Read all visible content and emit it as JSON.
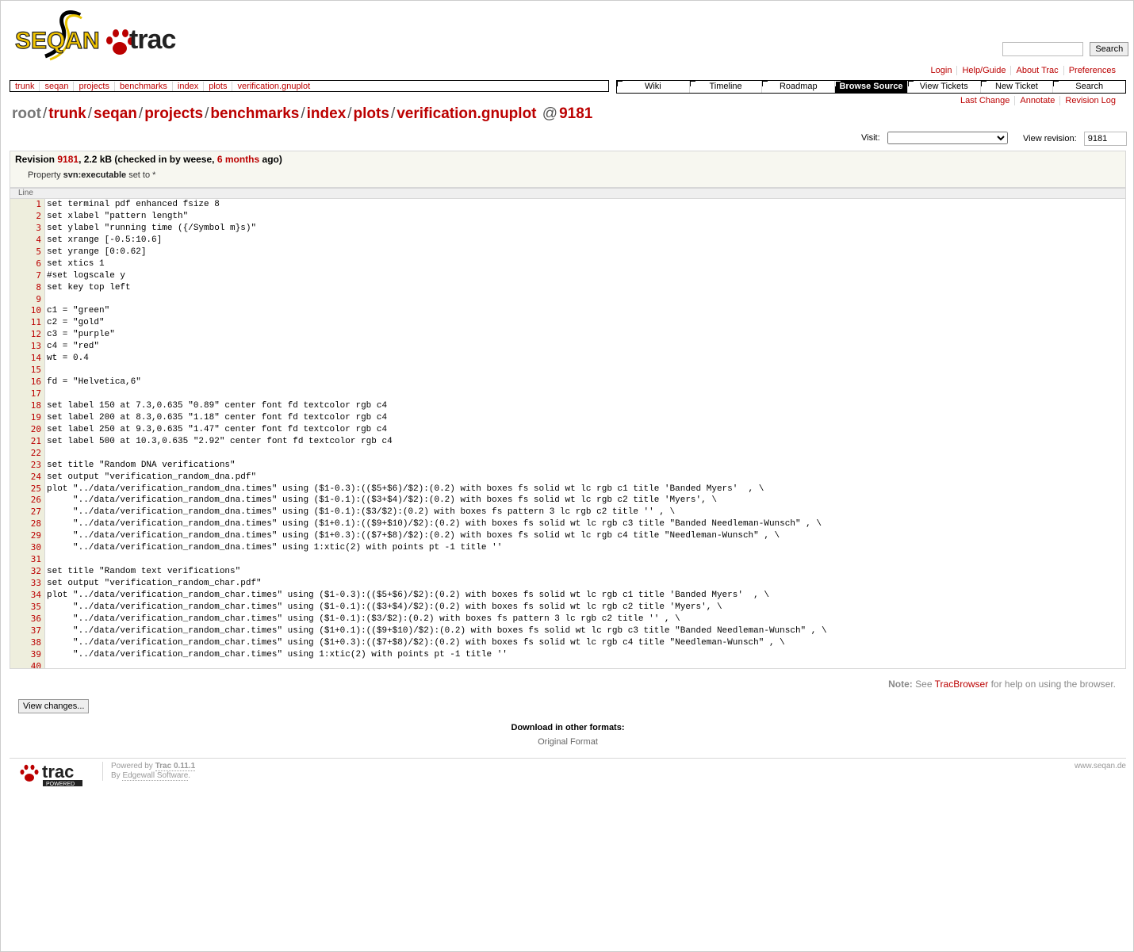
{
  "search": {
    "button_label": "Search",
    "placeholder": ""
  },
  "metanav": [
    "Login",
    "Help/Guide",
    "About Trac",
    "Preferences"
  ],
  "pathnav": [
    "trunk",
    "seqan",
    "projects",
    "benchmarks",
    "index",
    "plots",
    "verification.gnuplot"
  ],
  "mainnav": [
    "Wiki",
    "Timeline",
    "Roadmap",
    "Browse Source",
    "View Tickets",
    "New Ticket",
    "Search"
  ],
  "mainnav_active": "Browse Source",
  "ctxtnav": [
    "Last Change",
    "Annotate",
    "Revision Log"
  ],
  "path_title": {
    "root": "root",
    "parts": [
      "trunk",
      "seqan",
      "projects",
      "benchmarks",
      "index",
      "plots",
      "verification.gnuplot"
    ],
    "at": "@",
    "revision": "9181"
  },
  "visit": {
    "label": "Visit:",
    "selected": ""
  },
  "view_revision": {
    "label": "View revision:",
    "value": "9181"
  },
  "info": {
    "revision_label": "Revision",
    "revision": "9181",
    "size_text": ", 2.2 kB (checked in by weese,",
    "age": "6 months",
    "age_suffix": "ago)",
    "property_prefix": "Property",
    "property_name": "svn:executable",
    "property_suffix": "set to *"
  },
  "code_header": "Line",
  "code_lines": [
    "set terminal pdf enhanced fsize 8",
    "set xlabel \"pattern length\"",
    "set ylabel \"running time ({/Symbol m}s)\"",
    "set xrange [-0.5:10.6]",
    "set yrange [0:0.62]",
    "set xtics 1",
    "#set logscale y",
    "set key top left",
    "",
    "c1 = \"green\"",
    "c2 = \"gold\"",
    "c3 = \"purple\"",
    "c4 = \"red\"",
    "wt = 0.4",
    "",
    "fd = \"Helvetica,6\"",
    "",
    "set label 150 at 7.3,0.635 \"0.89\" center font fd textcolor rgb c4",
    "set label 200 at 8.3,0.635 \"1.18\" center font fd textcolor rgb c4",
    "set label 250 at 9.3,0.635 \"1.47\" center font fd textcolor rgb c4",
    "set label 500 at 10.3,0.635 \"2.92\" center font fd textcolor rgb c4",
    "",
    "set title \"Random DNA verifications\"",
    "set output \"verification_random_dna.pdf\"",
    "plot \"../data/verification_random_dna.times\" using ($1-0.3):(($5+$6)/$2):(0.2) with boxes fs solid wt lc rgb c1 title 'Banded Myers'  , \\",
    "     \"../data/verification_random_dna.times\" using ($1-0.1):(($3+$4)/$2):(0.2) with boxes fs solid wt lc rgb c2 title 'Myers', \\",
    "     \"../data/verification_random_dna.times\" using ($1-0.1):($3/$2):(0.2) with boxes fs pattern 3 lc rgb c2 title '' , \\",
    "     \"../data/verification_random_dna.times\" using ($1+0.1):(($9+$10)/$2):(0.2) with boxes fs solid wt lc rgb c3 title \"Banded Needleman-Wunsch\" , \\",
    "     \"../data/verification_random_dna.times\" using ($1+0.3):(($7+$8)/$2):(0.2) with boxes fs solid wt lc rgb c4 title \"Needleman-Wunsch\" , \\",
    "     \"../data/verification_random_dna.times\" using 1:xtic(2) with points pt -1 title ''",
    "",
    "set title \"Random text verifications\"",
    "set output \"verification_random_char.pdf\"",
    "plot \"../data/verification_random_char.times\" using ($1-0.3):(($5+$6)/$2):(0.2) with boxes fs solid wt lc rgb c1 title 'Banded Myers'  , \\",
    "     \"../data/verification_random_char.times\" using ($1-0.1):(($3+$4)/$2):(0.2) with boxes fs solid wt lc rgb c2 title 'Myers', \\",
    "     \"../data/verification_random_char.times\" using ($1-0.1):($3/$2):(0.2) with boxes fs pattern 3 lc rgb c2 title '' , \\",
    "     \"../data/verification_random_char.times\" using ($1+0.1):(($9+$10)/$2):(0.2) with boxes fs solid wt lc rgb c3 title \"Banded Needleman-Wunsch\" , \\",
    "     \"../data/verification_random_char.times\" using ($1+0.3):(($7+$8)/$2):(0.2) with boxes fs solid wt lc rgb c4 title \"Needleman-Wunsch\" , \\",
    "     \"../data/verification_random_char.times\" using 1:xtic(2) with points pt -1 title ''",
    ""
  ],
  "note": {
    "label": "Note:",
    "prefix": "See",
    "link": "TracBrowser",
    "suffix": "for help on using the browser."
  },
  "view_changes_label": "View changes...",
  "altlinks": {
    "heading": "Download in other formats:",
    "format": "Original Format"
  },
  "footer": {
    "powered_by": "Powered by",
    "trac_version": "Trac 0.11.1",
    "by": "By",
    "vendor": "Edgewall Software",
    "period": ".",
    "site": "www.seqan.de",
    "logo_text": "trac",
    "logo_sub": "POWERED"
  },
  "logo": {
    "part1": "SEQAN",
    "part2": "trac"
  },
  "colors": {
    "link": "#bb0000",
    "active_tab": "#000000",
    "line_gutter": "#eeeedd"
  }
}
